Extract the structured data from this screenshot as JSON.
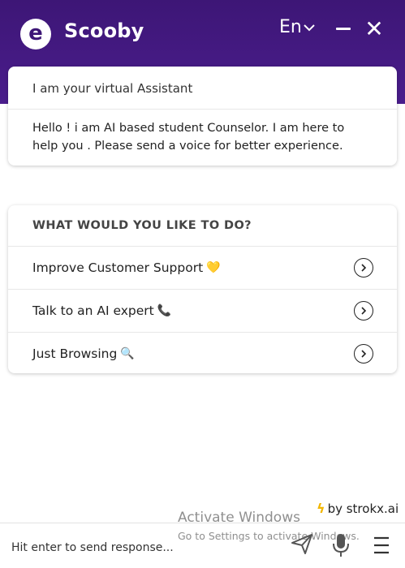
{
  "header": {
    "logo_letter": "e",
    "brand": "Scooby",
    "language": "En",
    "language_icon": "chevron-down-icon",
    "minimize_icon": "minimize-icon",
    "close_symbol": "✕",
    "close_icon": "close-icon",
    "background_color": "#3d1676"
  },
  "intro": {
    "title": "I am your virtual Assistant",
    "message": "Hello ! i am AI based student Counselor. I am here to help you . Please send a voice for better experience."
  },
  "menu": {
    "heading": "WHAT WOULD YOU LIKE TO DO?",
    "items": [
      {
        "label": "Improve Customer Support",
        "emoji": "💛",
        "icon": "chevron-right-circle-icon"
      },
      {
        "label": "Talk to an AI expert",
        "emoji": "📞",
        "icon": "chevron-right-circle-icon"
      },
      {
        "label": "Just Browsing",
        "emoji": "🔍",
        "icon": "chevron-right-circle-icon"
      }
    ]
  },
  "footer": {
    "powered_by": "by strokx.ai",
    "bolt_icon": "lightning-icon",
    "input_placeholder": "Hit enter to send response...",
    "send_icon": "send-icon",
    "mic_icon": "microphone-icon",
    "menu_icon": "menu-icon"
  },
  "watermark": {
    "line1": "Activate Windows",
    "line2": "Go to Settings to activate Windows."
  }
}
